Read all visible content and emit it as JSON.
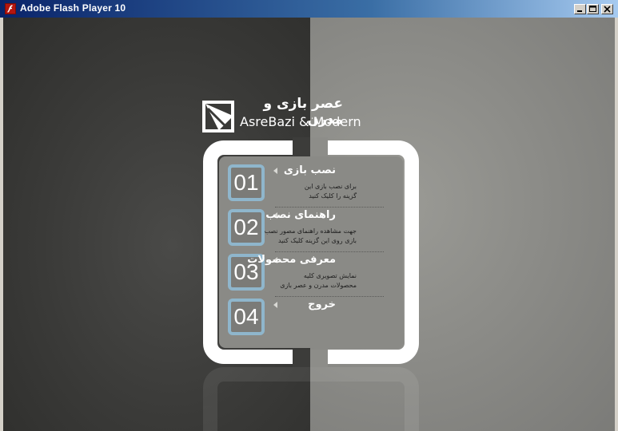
{
  "window": {
    "title": "Adobe Flash Player 10",
    "controls": [
      "minimize-icon",
      "maximize-icon",
      "close-icon"
    ]
  },
  "brand": {
    "persian": "عصر بازی و مدرن",
    "english": "AsreBazi & Modern",
    "logo_icon": "diagonal-arrow-logo-icon"
  },
  "colors": {
    "left_background": "#3a3a38",
    "right_background": "#8c8c88",
    "panel": "#8a8a86",
    "number_border": "#8fb6cc"
  },
  "menu": {
    "items": [
      {
        "number": "01",
        "title": "نصب بازی",
        "desc_line1": "برای نصب بازی این",
        "desc_line2": "گزینه را کلیک کنید"
      },
      {
        "number": "02",
        "title": "راهنمای نصب",
        "desc_line1": "جهت مشاهده راهنمای مصور نصب",
        "desc_line2": "بازی روی این گزینه کلیک کنید"
      },
      {
        "number": "03",
        "title": "معرفی محصولات",
        "desc_line1": "نمایش تصویری کلیه",
        "desc_line2": "محصولات مدرن و عصر بازی"
      },
      {
        "number": "04",
        "title": "خروج",
        "desc_line1": "",
        "desc_line2": ""
      }
    ]
  }
}
